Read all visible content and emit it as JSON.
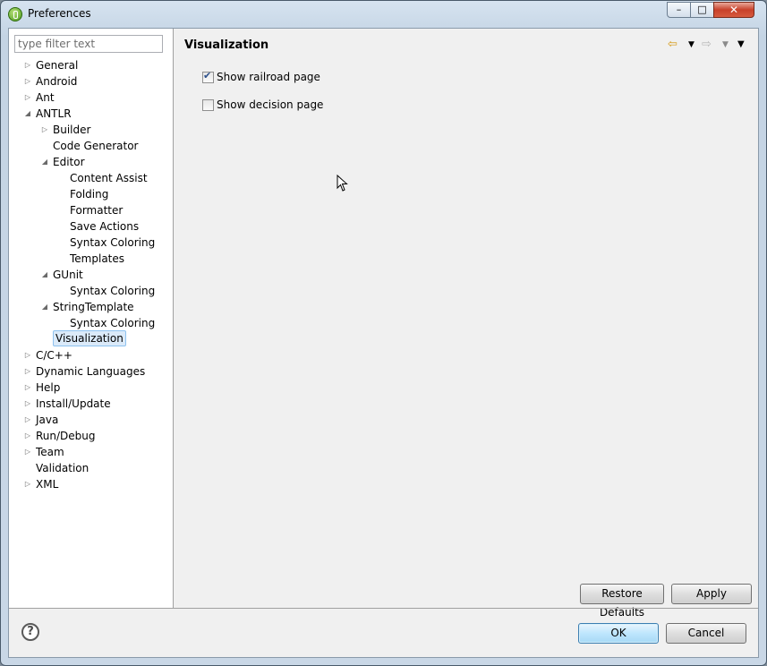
{
  "window": {
    "title": "Preferences",
    "controls": {
      "minimize": "–",
      "maximize": "□",
      "close": "✕"
    }
  },
  "filter": {
    "placeholder": "type filter text"
  },
  "tree": [
    {
      "label": "General",
      "twisty": "collapsed",
      "depth": 0
    },
    {
      "label": "Android",
      "twisty": "collapsed",
      "depth": 0
    },
    {
      "label": "Ant",
      "twisty": "collapsed",
      "depth": 0
    },
    {
      "label": "ANTLR",
      "twisty": "expanded",
      "depth": 0
    },
    {
      "label": "Builder",
      "twisty": "collapsed",
      "depth": 1
    },
    {
      "label": "Code Generator",
      "twisty": "none",
      "depth": 1
    },
    {
      "label": "Editor",
      "twisty": "expanded",
      "depth": 1
    },
    {
      "label": "Content Assist",
      "twisty": "none",
      "depth": 2
    },
    {
      "label": "Folding",
      "twisty": "none",
      "depth": 2
    },
    {
      "label": "Formatter",
      "twisty": "none",
      "depth": 2
    },
    {
      "label": "Save Actions",
      "twisty": "none",
      "depth": 2
    },
    {
      "label": "Syntax Coloring",
      "twisty": "none",
      "depth": 2
    },
    {
      "label": "Templates",
      "twisty": "none",
      "depth": 2
    },
    {
      "label": "GUnit",
      "twisty": "expanded",
      "depth": 1
    },
    {
      "label": "Syntax Coloring",
      "twisty": "none",
      "depth": 2
    },
    {
      "label": "StringTemplate",
      "twisty": "expanded",
      "depth": 1
    },
    {
      "label": "Syntax Coloring",
      "twisty": "none",
      "depth": 2
    },
    {
      "label": "Visualization",
      "twisty": "none",
      "depth": 1,
      "selected": true
    },
    {
      "label": "C/C++",
      "twisty": "collapsed",
      "depth": 0
    },
    {
      "label": "Dynamic Languages",
      "twisty": "collapsed",
      "depth": 0
    },
    {
      "label": "Help",
      "twisty": "collapsed",
      "depth": 0
    },
    {
      "label": "Install/Update",
      "twisty": "collapsed",
      "depth": 0
    },
    {
      "label": "Java",
      "twisty": "collapsed",
      "depth": 0
    },
    {
      "label": "Run/Debug",
      "twisty": "collapsed",
      "depth": 0
    },
    {
      "label": "Team",
      "twisty": "collapsed",
      "depth": 0
    },
    {
      "label": "Validation",
      "twisty": "none",
      "depth": 0
    },
    {
      "label": "XML",
      "twisty": "collapsed",
      "depth": 0
    }
  ],
  "page": {
    "title": "Visualization",
    "nav": {
      "back": "⇦",
      "back_dropdown": "▼",
      "forward": "⇨",
      "forward_dropdown": "▼",
      "menu": "▼"
    },
    "options": [
      {
        "label": "Show railroad page",
        "checked": true
      },
      {
        "label": "Show decision page",
        "checked": false
      }
    ]
  },
  "buttons": {
    "restore_defaults": "Restore Defaults",
    "apply": "Apply",
    "ok": "OK",
    "cancel": "Cancel",
    "help": "?"
  },
  "colors": {
    "selection_bg": "#dbeaf9",
    "selection_border": "#8ec2ef",
    "ok_border": "#3c7fb1"
  }
}
